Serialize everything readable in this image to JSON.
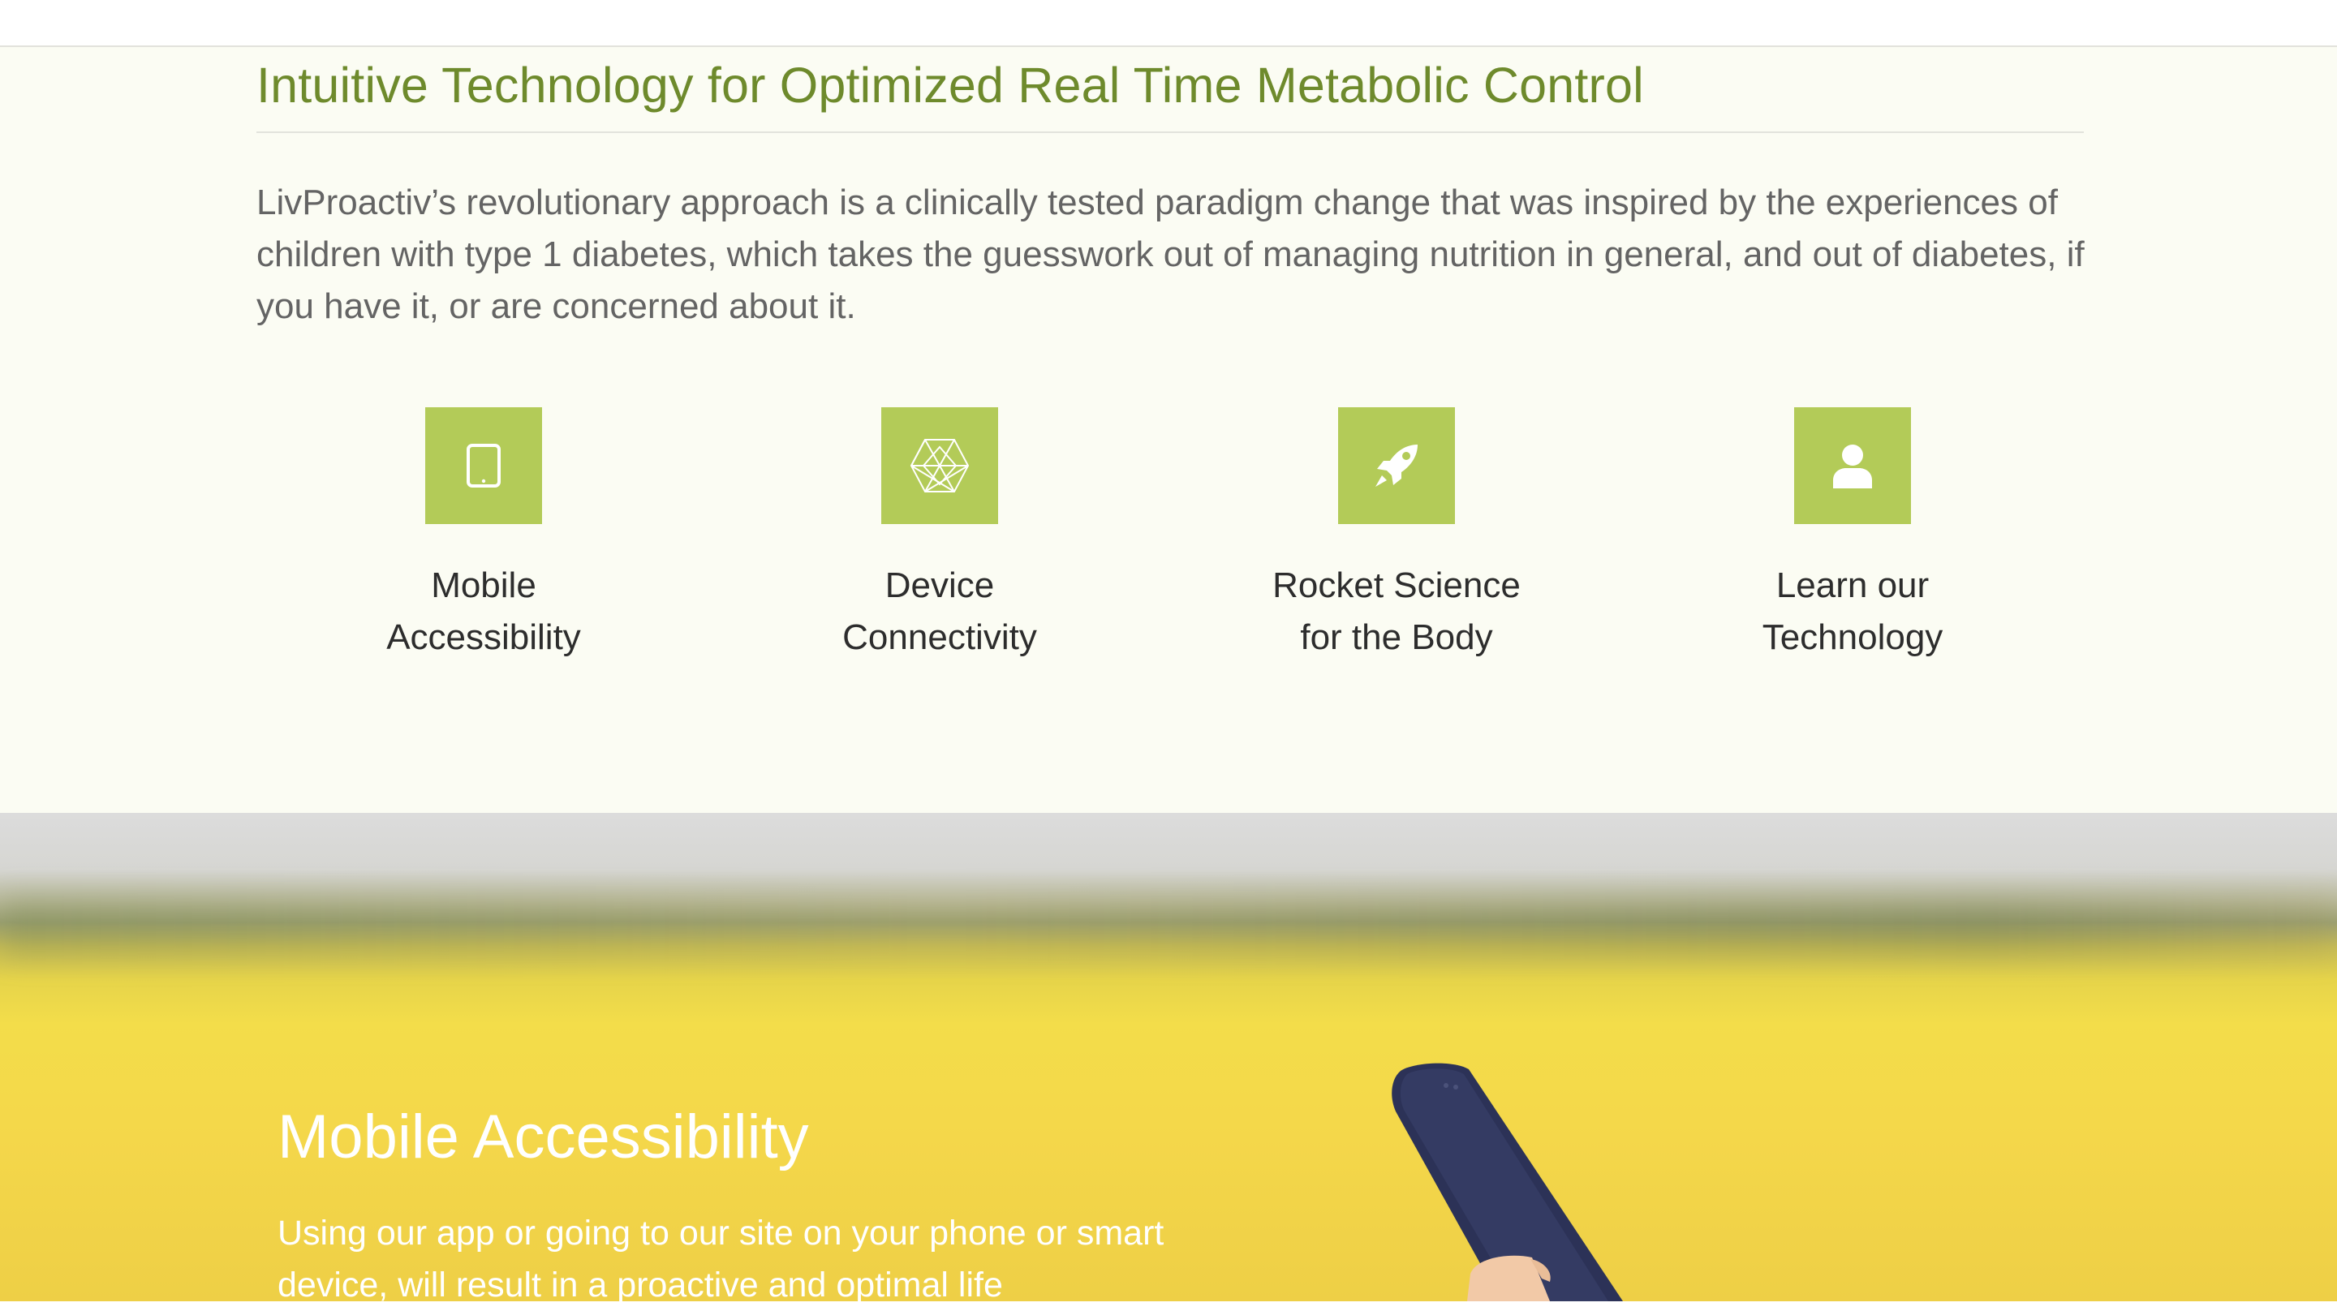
{
  "intro": {
    "title": "Intuitive Technology for Optimized Real Time Metabolic Control",
    "lead": "LivProactiv’s revolutionary approach is a clinically tested paradigm change that was inspired by the experiences of children with type 1 diabetes, which takes the guesswork out of managing nutrition in general, and out of diabetes, if you have it, or are concerned about it."
  },
  "features": [
    {
      "icon": "tablet-icon",
      "line1": "Mobile",
      "line2": "Accessibility"
    },
    {
      "icon": "hexagon-mesh-icon",
      "line1": "Device",
      "line2": "Connectivity"
    },
    {
      "icon": "rocket-icon",
      "line1": "Rocket Science",
      "line2": "for the Body"
    },
    {
      "icon": "user-icon",
      "line1": "Learn our",
      "line2": "Technology"
    }
  ],
  "hero": {
    "title": "Mobile Accessibility",
    "text": "Using our app or going to our site on your phone or smart device, will result in a proactive and optimal life"
  },
  "colors": {
    "accent": "#b3cb58",
    "title_green": "#6e8a2c",
    "intro_bg": "#fbfcf3"
  }
}
